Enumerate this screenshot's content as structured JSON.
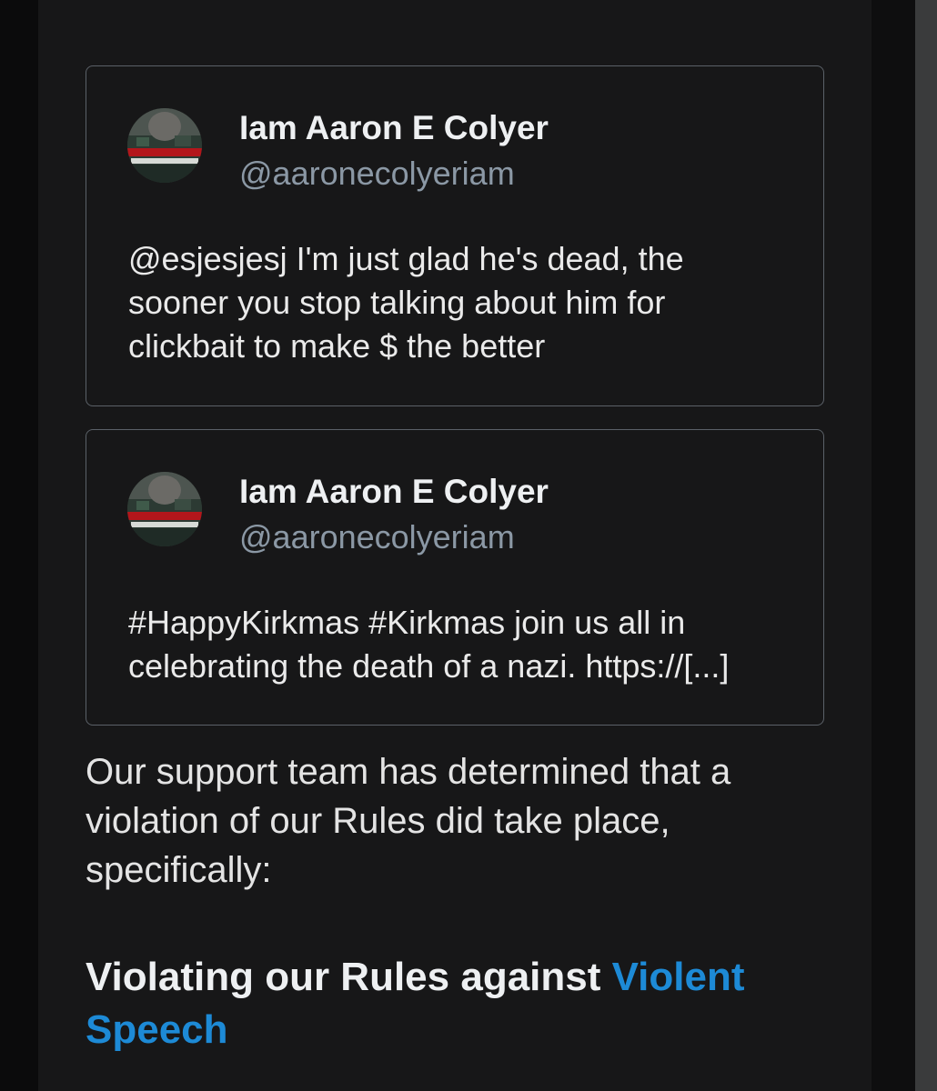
{
  "tweets": [
    {
      "display_name": "Iam Aaron E Colyer",
      "handle": "@aaronecolyeriam",
      "text_lines": [
        "@esjesjesj I'm just glad he's dead, the",
        "sooner you stop talking about him for",
        "clickbait to make $ the better"
      ]
    },
    {
      "display_name": "Iam Aaron E Colyer",
      "handle": "@aaronecolyeriam",
      "text_lines": [
        "#HappyKirkmas #Kirkmas join us all in",
        "celebrating the death of a nazi. https://[...]"
      ]
    }
  ],
  "message": {
    "lines": [
      "Our support team has determined that a",
      "violation of our Rules did take place,",
      "specifically:"
    ]
  },
  "rule": {
    "prefix": "Violating our Rules against ",
    "link_line1": "Violent",
    "link_line2": "Speech"
  },
  "colors": {
    "link": "#1d8ad6",
    "handle": "#8b98a5",
    "card_border": "#5b6168"
  }
}
